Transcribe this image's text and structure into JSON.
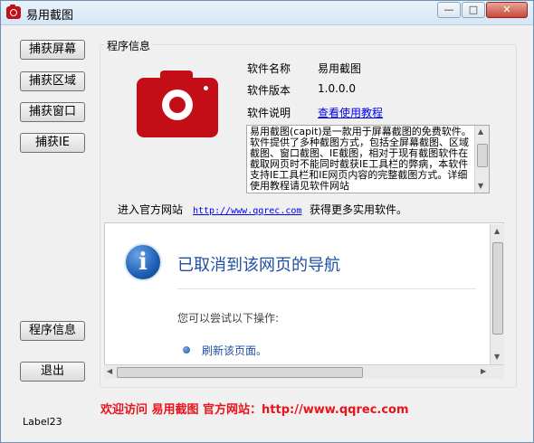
{
  "window": {
    "title": "易用截图"
  },
  "sidebar": {
    "buttons": [
      "捕获屏幕",
      "捕获区域",
      "捕获窗口",
      "捕获IE"
    ],
    "info_button": "程序信息",
    "exit_button": "退出",
    "status_label": "Label23"
  },
  "program_info": {
    "group_title": "程序信息",
    "name_label": "软件名称",
    "name_value": "易用截图",
    "version_label": "软件版本",
    "version_value": "1.0.0.0",
    "desc_label": "软件说明",
    "desc_link": "查看使用教程",
    "description": "易用截图(capit)是一款用于屏幕截图的免费软件。软件提供了多种截图方式，包括全屏幕截图、区域截图、窗口截图、IE截图，相对于现有截图软件在截取网页时不能同时截获IE工具栏的弊病，本软件支持IE工具栏和IE网页内容的完整截图方式。详细使用教程请见软件网站",
    "site_prefix": "进入官方网站",
    "site_url": "http://www.qqrec.com",
    "site_suffix": "获得更多实用软件。"
  },
  "webview": {
    "title": "已取消到该网页的导航",
    "subtitle": "您可以尝试以下操作:",
    "refresh_link": "刷新该页面。"
  },
  "footer_text": "欢迎访问 易用截图 官方网站：http://www.qqrec.com",
  "colors": {
    "accent_red": "#c40e17",
    "link_blue": "#0000ee",
    "footer_red": "#e8131b",
    "ie_blue": "#1f4fa3"
  }
}
